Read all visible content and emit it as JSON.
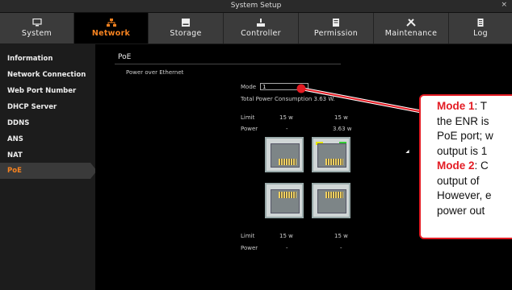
{
  "window": {
    "title": "System Setup",
    "close": "×"
  },
  "tabs": [
    {
      "label": "System",
      "icon": "monitor-icon"
    },
    {
      "label": "Network",
      "icon": "network-icon"
    },
    {
      "label": "Storage",
      "icon": "storage-icon"
    },
    {
      "label": "Controller",
      "icon": "controller-icon"
    },
    {
      "label": "Permission",
      "icon": "permission-icon"
    },
    {
      "label": "Maintenance",
      "icon": "tools-icon"
    },
    {
      "label": "Log",
      "icon": "log-icon"
    }
  ],
  "sidebar": {
    "items": [
      {
        "label": "Information"
      },
      {
        "label": "Network Connection"
      },
      {
        "label": "Web Port Number"
      },
      {
        "label": "DHCP Server"
      },
      {
        "label": "DDNS"
      },
      {
        "label": "ANS"
      },
      {
        "label": "NAT"
      },
      {
        "label": "PoE"
      }
    ]
  },
  "poe": {
    "title": "PoE",
    "subtitle": "Power over Ethernet",
    "mode_label": "Mode",
    "mode_value": "1",
    "total_power": "Total Power Consumption 3.63 W.",
    "top": {
      "limit_label": "Limit",
      "power_label": "Power",
      "limit_1": "15 w",
      "limit_2": "15 w",
      "power_1": "-",
      "power_2": "3.63 w"
    },
    "bottom": {
      "limit_label": "Limit",
      "power_label": "Power",
      "limit_1": "15 w",
      "limit_2": "15 w",
      "power_1": "-",
      "power_2": "-"
    }
  },
  "callout": {
    "mode1_title": "Mode 1",
    "mode1_text_a": ": T",
    "line2": "the ENR is",
    "line3": "PoE port; w",
    "line4": "output is 1",
    "mode2_title": "Mode 2",
    "mode2_text_a": ": C",
    "line6": "output of",
    "line7": "However, e",
    "line8": "power out"
  },
  "colors": {
    "accent": "#f58220",
    "callout_red": "#e31b23"
  }
}
